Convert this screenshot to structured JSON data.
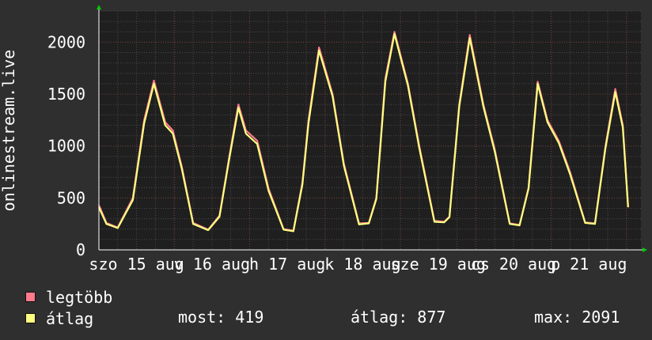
{
  "chart_data": {
    "type": "line",
    "ylabel": "onlinestream.live",
    "ylim": [
      0,
      2300
    ],
    "yticks": [
      0,
      500,
      1000,
      1500,
      2000
    ],
    "x_tick_labels": [
      "szo 15 aug",
      "v 16 aug",
      "h 17 aug",
      "k 18 aug",
      "sze 19 aug",
      "cs 20 aug",
      "p 21 aug"
    ],
    "x_range_days": [
      0,
      7.19
    ],
    "grid": true,
    "series": [
      {
        "name": "legtöbb",
        "color": "#ff7a8a",
        "x": [
          0,
          0.1,
          0.25,
          0.45,
          0.6,
          0.73,
          0.88,
          0.98,
          1.1,
          1.25,
          1.45,
          1.6,
          1.73,
          1.85,
          1.95,
          2.1,
          2.25,
          2.45,
          2.58,
          2.7,
          2.78,
          2.92,
          3.1,
          3.25,
          3.45,
          3.58,
          3.68,
          3.8,
          3.92,
          4.1,
          4.25,
          4.45,
          4.58,
          4.65,
          4.78,
          4.92,
          5.1,
          5.25,
          5.45,
          5.58,
          5.7,
          5.82,
          5.95,
          6.1,
          6.25,
          6.45,
          6.58,
          6.72,
          6.85,
          6.95,
          7.02
        ],
        "values": [
          430,
          260,
          215,
          500,
          1250,
          1630,
          1230,
          1150,
          800,
          260,
          195,
          330,
          900,
          1400,
          1150,
          1050,
          590,
          200,
          185,
          650,
          1250,
          1950,
          1500,
          830,
          255,
          260,
          500,
          1650,
          2100,
          1600,
          1000,
          280,
          270,
          320,
          1400,
          2070,
          1400,
          970,
          255,
          240,
          600,
          1620,
          1250,
          1050,
          750,
          265,
          255,
          1000,
          1550,
          1200,
          420
        ]
      },
      {
        "name": "átlag",
        "color": "#ffff80",
        "x": [
          0,
          0.1,
          0.25,
          0.45,
          0.6,
          0.73,
          0.88,
          0.98,
          1.1,
          1.25,
          1.45,
          1.6,
          1.73,
          1.85,
          1.95,
          2.1,
          2.25,
          2.45,
          2.58,
          2.7,
          2.78,
          2.92,
          3.1,
          3.25,
          3.45,
          3.58,
          3.68,
          3.8,
          3.92,
          4.1,
          4.25,
          4.45,
          4.58,
          4.65,
          4.78,
          4.92,
          5.1,
          5.25,
          5.45,
          5.58,
          5.7,
          5.82,
          5.95,
          6.1,
          6.25,
          6.45,
          6.58,
          6.72,
          6.85,
          6.95,
          7.02
        ],
        "values": [
          410,
          250,
          210,
          480,
          1220,
          1600,
          1200,
          1120,
          780,
          250,
          190,
          320,
          880,
          1370,
          1120,
          1020,
          570,
          195,
          180,
          630,
          1220,
          1920,
          1480,
          810,
          245,
          255,
          490,
          1620,
          2080,
          1580,
          980,
          270,
          265,
          315,
          1380,
          2040,
          1380,
          950,
          250,
          235,
          590,
          1600,
          1230,
          1030,
          730,
          260,
          250,
          980,
          1520,
          1180,
          410
        ]
      }
    ]
  },
  "legend": {
    "max_label": "legtöbb",
    "avg_label": "átlag",
    "max_color": "#ff7a8a",
    "avg_color": "#ffff80"
  },
  "stats": {
    "most": "most: 419",
    "atlag": "átlag: 877",
    "max": "max: 2091"
  }
}
